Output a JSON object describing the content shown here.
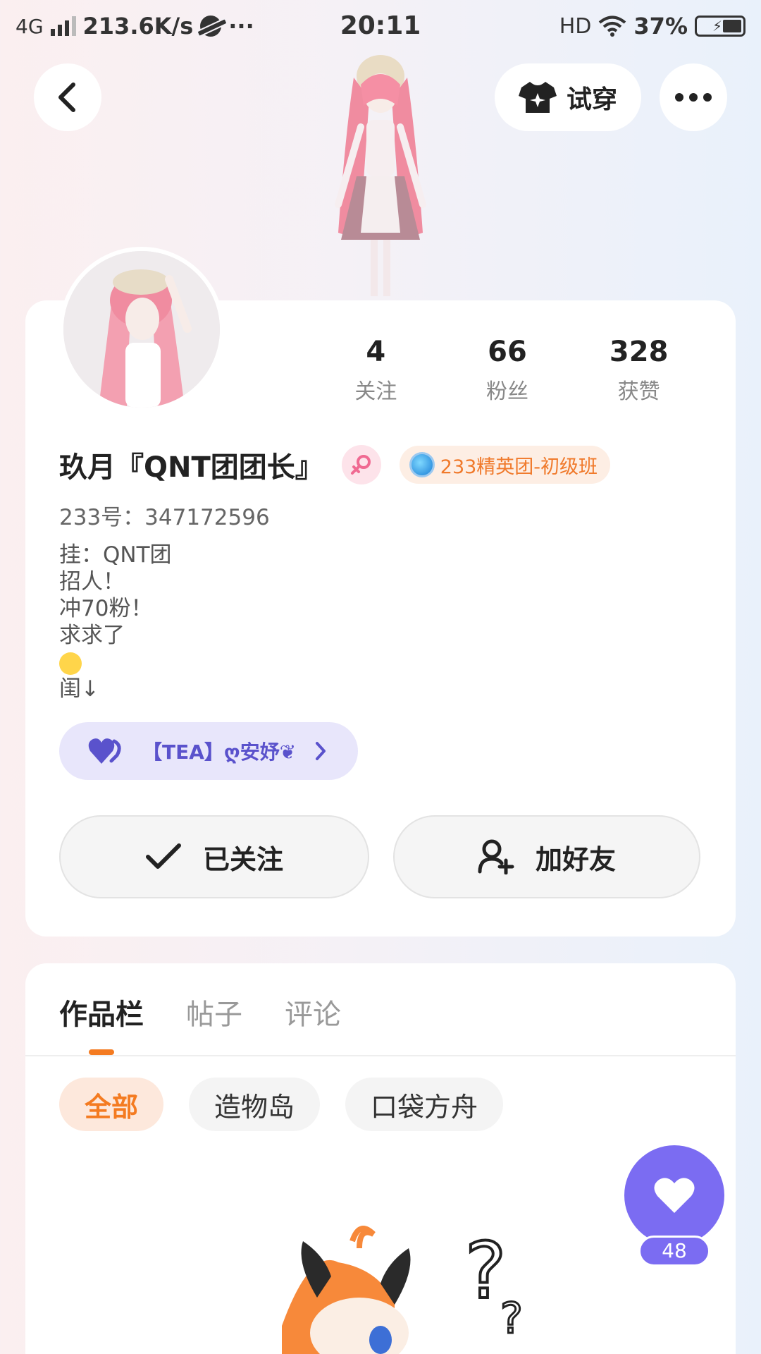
{
  "status_bar": {
    "network": "4G",
    "speed": "213.6K/s",
    "more": "···",
    "time": "20:11",
    "hd": "HD",
    "battery": "37%"
  },
  "header": {
    "try_on_label": "试穿"
  },
  "profile": {
    "stats": [
      {
        "value": "4",
        "label": "关注"
      },
      {
        "value": "66",
        "label": "粉丝"
      },
      {
        "value": "328",
        "label": "获赞"
      }
    ],
    "nickname": "玖月『QNT团团长』",
    "badge": "233精英团-初级班",
    "uid": "233号：347172596",
    "bio_lines": [
      "挂：QNT团",
      "招人！",
      "冲70粉！",
      "求求了",
      "",
      "闺↓"
    ],
    "group_chip": "【TEA】ღ安妤❦",
    "followed_label": "已关注",
    "add_friend_label": "加好友"
  },
  "works": {
    "tabs": [
      "作品栏",
      "帖子",
      "评论"
    ],
    "filters": [
      "全部",
      "造物岛",
      "口袋方舟"
    ]
  },
  "like_fab": {
    "count": "48"
  },
  "colors": {
    "accent_orange": "#f47b21",
    "accent_purple": "#7b6cf2",
    "chip_purple_bg": "#e8e6fb"
  },
  "icons": {
    "back": "chevron-left-icon",
    "tryon": "tshirt-icon",
    "more": "more-dots-icon",
    "gender": "female-icon",
    "group": "heart-icon",
    "followed": "check-icon",
    "add_friend": "add-user-icon",
    "like": "heart-icon"
  }
}
